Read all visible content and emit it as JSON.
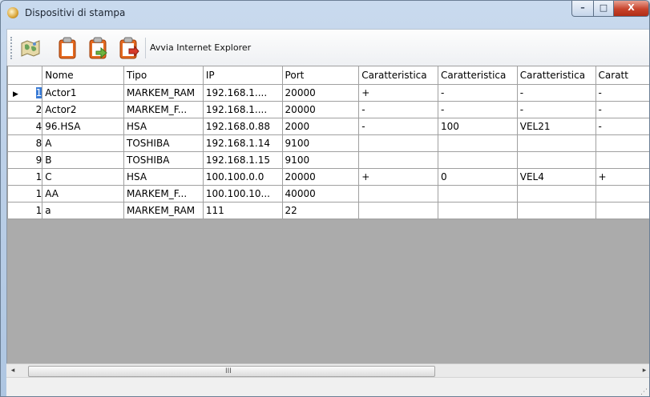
{
  "window": {
    "title": "Dispositivi di stampa",
    "controls": {
      "minimize": "–",
      "maximize": "□",
      "close": "X"
    }
  },
  "toolbar": {
    "buttons": [
      {
        "icon": "world-map-icon"
      },
      {
        "icon": "clipboard-icon"
      },
      {
        "icon": "clipboard-check-icon"
      },
      {
        "icon": "clipboard-delete-icon"
      }
    ],
    "label": "Avvia Internet Explorer"
  },
  "grid": {
    "columns": [
      "Nome",
      "Tipo",
      "IP",
      "Port",
      "Caratteristica",
      "Caratteristica",
      "Caratteristica",
      "Caratt"
    ],
    "rows": [
      {
        "id": "1",
        "cells": [
          "Actor1",
          "MARKEM_RAM",
          "192.168.1....",
          "20000",
          "+",
          "-",
          "-",
          "-"
        ]
      },
      {
        "id": "2",
        "cells": [
          "Actor2",
          "MARKEM_F...",
          "192.168.1....",
          "20000",
          "-",
          "-",
          "-",
          "-"
        ]
      },
      {
        "id": "4",
        "cells": [
          "96.HSA",
          "HSA",
          "192.168.0.88",
          "2000",
          "-",
          "100",
          "VEL21",
          "-"
        ]
      },
      {
        "id": "8",
        "cells": [
          "A",
          "TOSHIBA",
          "192.168.1.14",
          "9100",
          "",
          "",
          "",
          ""
        ]
      },
      {
        "id": "9",
        "cells": [
          "B",
          "TOSHIBA",
          "192.168.1.15",
          "9100",
          "",
          "",
          "",
          ""
        ]
      },
      {
        "id": "1",
        "cells": [
          "C",
          "HSA",
          "100.100.0.0",
          "20000",
          "+",
          "0",
          "VEL4",
          "+"
        ]
      },
      {
        "id": "1",
        "cells": [
          "AA",
          "MARKEM_F...",
          "100.100.10...",
          "40000",
          "",
          "",
          "",
          ""
        ]
      },
      {
        "id": "1",
        "cells": [
          "a",
          "MARKEM_RAM",
          "111",
          "22",
          "",
          "",
          "",
          ""
        ]
      }
    ],
    "current_row_indicator": "▶"
  },
  "scrollbar": {
    "left_arrow": "◂",
    "right_arrow": "▸",
    "grip": "III"
  }
}
